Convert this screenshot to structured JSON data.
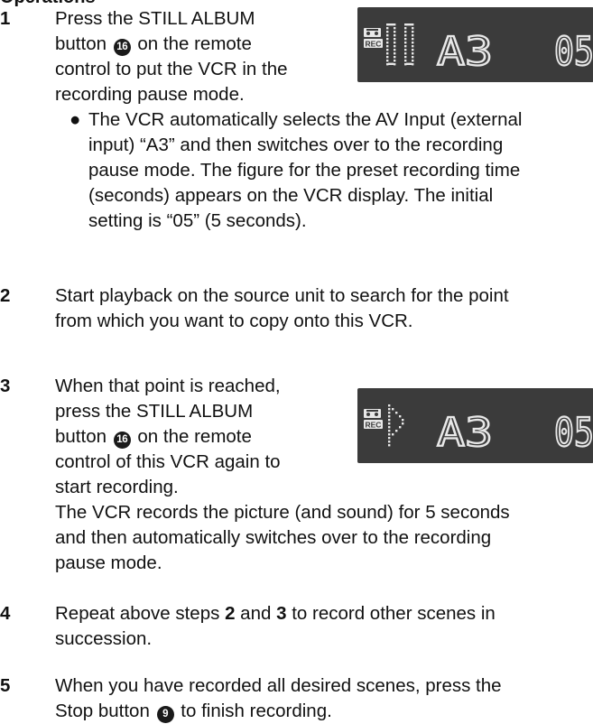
{
  "heading": "Operations",
  "steps": [
    {
      "num": "1",
      "lines": [
        "Press the STILL ALBUM",
        "button",
        "on the remote",
        "control to put the VCR in the",
        "recording pause mode."
      ],
      "button_num": "16"
    },
    {
      "bullet": "●",
      "lines": [
        "The VCR automatically selects the AV Input (external",
        "input) “A3” and then switches over to the recording",
        "pause mode. The figure for the preset recording time",
        "(seconds) appears on the VCR display. The initial",
        "setting is “05” (5 seconds)."
      ]
    },
    {
      "num": "2",
      "lines": [
        "Start playback on the source unit to search for the point",
        "from which you want to copy onto this VCR."
      ]
    },
    {
      "num": "3",
      "lines": [
        "When that point is reached,",
        "press the STILL ALBUM",
        "button",
        "on the remote",
        "control of this VCR again to",
        "start recording."
      ],
      "button_num": "16",
      "follow": [
        "The VCR records the picture (and sound) for 5 seconds",
        "and then automatically switches over to the recording",
        "pause mode."
      ]
    },
    {
      "num": "4",
      "lines": [
        "Repeat above steps",
        "2",
        "and",
        "3",
        "to record other scenes in",
        "succession."
      ]
    },
    {
      "num": "5",
      "lines": [
        "When you have recorded all desired scenes, press the",
        "Stop button",
        "to finish recording."
      ],
      "button_num": "9"
    }
  ],
  "displays": [
    {
      "input": "A3",
      "time": "05",
      "mode": "pause"
    },
    {
      "input": "A3",
      "time": "05",
      "mode": "record"
    }
  ],
  "colors": {
    "lcd_bg": "#3b3b3b",
    "lcd_segment": "#e8e8e8",
    "text": "#111111"
  }
}
